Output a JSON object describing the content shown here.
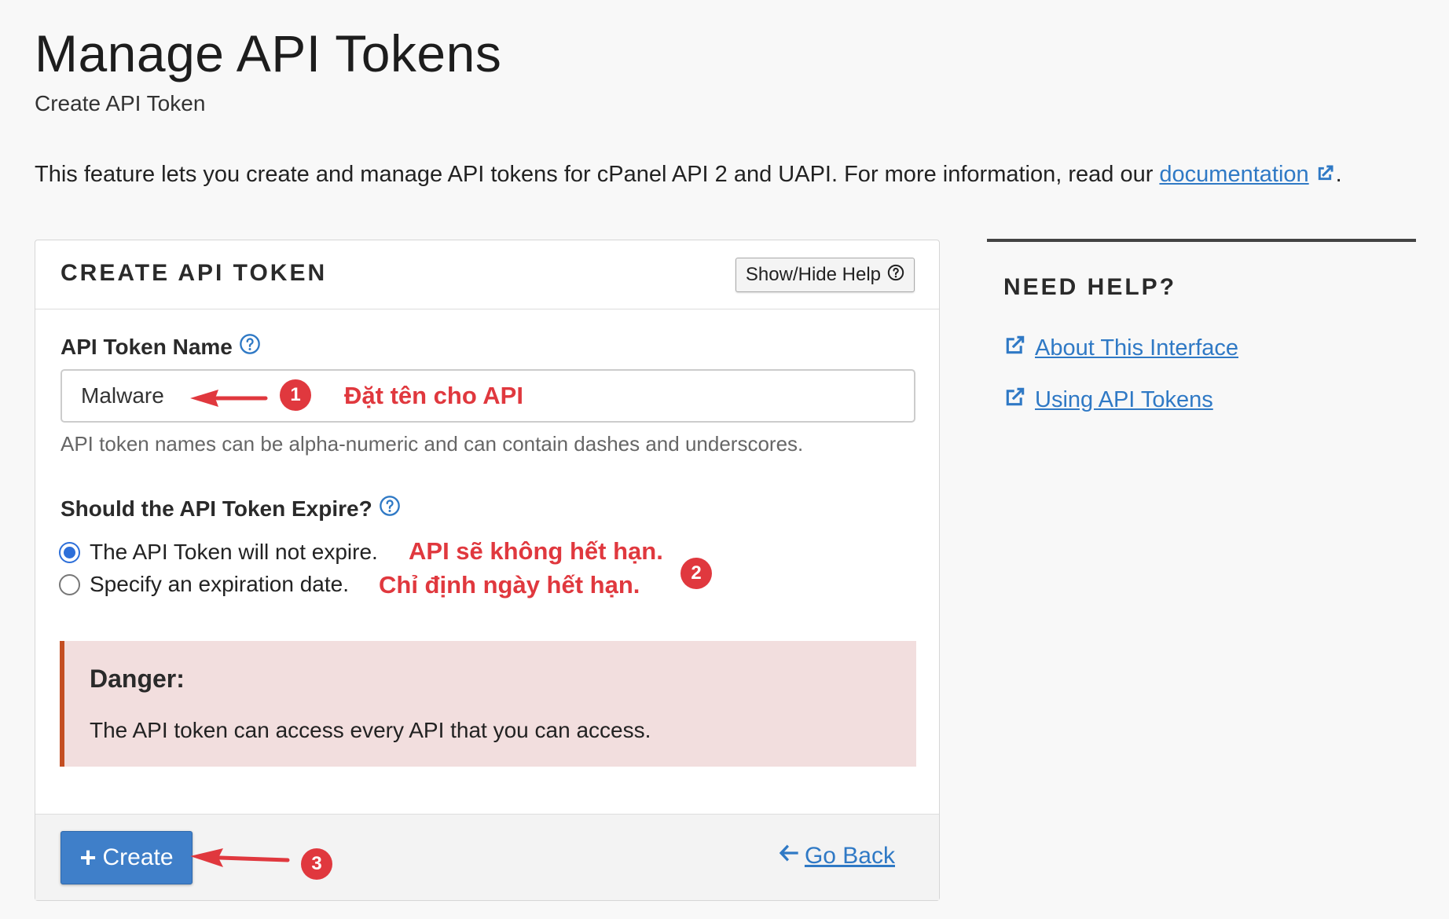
{
  "page": {
    "title": "Manage API Tokens",
    "subtitle": "Create API Token",
    "intro_text": "This feature lets you create and manage API tokens for cPanel API 2 and UAPI. For more information, read our ",
    "intro_link": "documentation",
    "intro_end": "."
  },
  "card": {
    "header_title": "CREATE API TOKEN",
    "help_button": "Show/Hide Help",
    "token_name_label": "API Token Name",
    "token_name_value": "Malware",
    "token_name_hint": "API token names can be alpha-numeric and can contain dashes and underscores.",
    "expire_label": "Should the API Token Expire?",
    "options": [
      {
        "label": "The API Token will not expire.",
        "checked": true
      },
      {
        "label": "Specify an expiration date.",
        "checked": false
      }
    ],
    "danger_title": "Danger:",
    "danger_text": "The API token can access every API that you can access.",
    "create_button": "Create",
    "go_back": "Go Back"
  },
  "sidebar": {
    "title": "NEED HELP?",
    "links": [
      "About This Interface",
      "Using API Tokens"
    ]
  },
  "annotations": {
    "name_note": "Đặt tên cho API",
    "no_expire_note": "API sẽ không hết hạn.",
    "expire_note": "Chỉ định ngày hết hạn.",
    "badges": [
      "1",
      "2",
      "3"
    ]
  },
  "colors": {
    "link": "#2f79c5",
    "primary_button": "#3f7fc9",
    "danger_bg": "#f2dede",
    "danger_border": "#c44e22",
    "annotation": "#e0383e"
  }
}
